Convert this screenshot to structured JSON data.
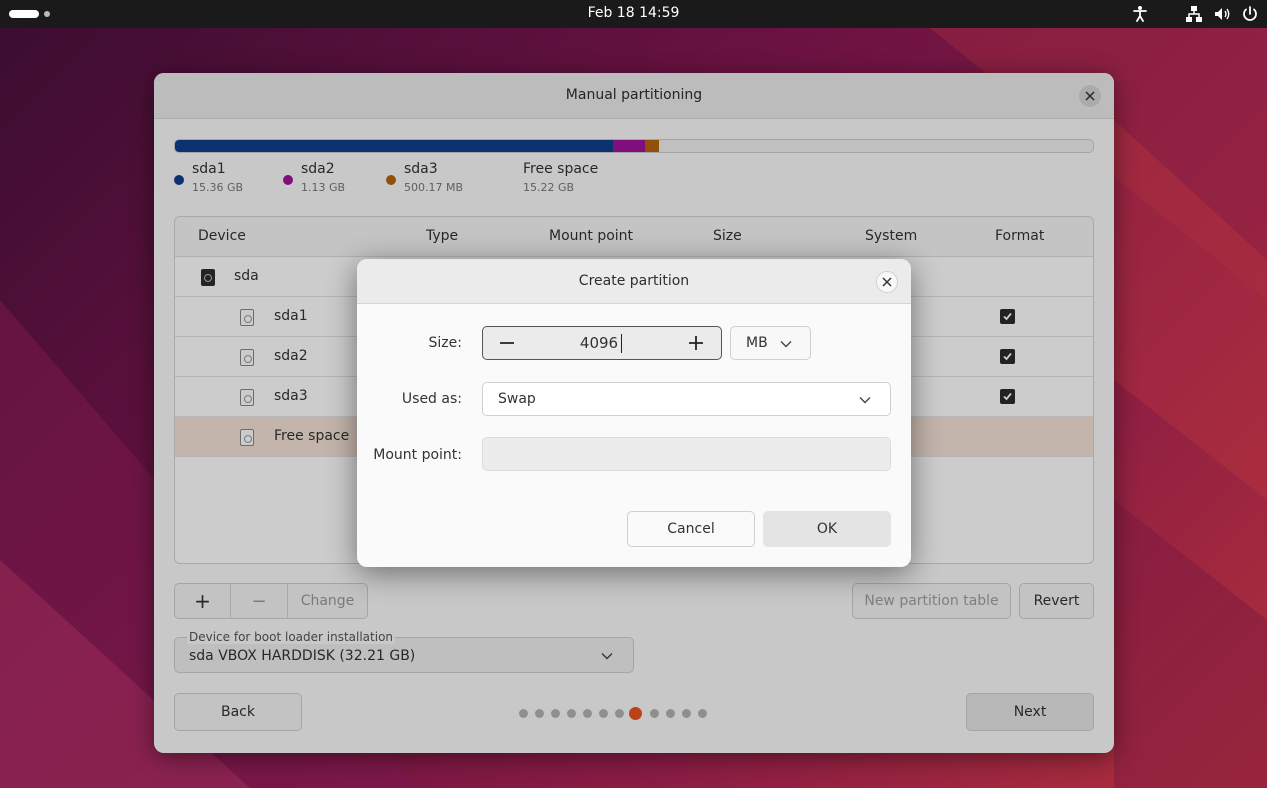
{
  "topbar": {
    "clock": "Feb 18  14:59",
    "icons": [
      "accessibility-icon",
      "network-icon",
      "volume-icon",
      "power-icon"
    ]
  },
  "window": {
    "title": "Manual partitioning",
    "usage_bar": [
      {
        "name": "sda1",
        "fraction": 0.4769,
        "color": "#0e3e8e"
      },
      {
        "name": "sda2",
        "fraction": 0.0351,
        "color": "#a0139a"
      },
      {
        "name": "sda3",
        "fraction": 0.0155,
        "color": "#b5650a"
      },
      {
        "name": "Free space",
        "fraction": 0.4725,
        "color": "#f0f0f0"
      }
    ],
    "legend": [
      {
        "name": "sda1",
        "size": "15.36 GB",
        "color": "#0e3e8e"
      },
      {
        "name": "sda2",
        "size": "1.13 GB",
        "color": "#a0139a"
      },
      {
        "name": "sda3",
        "size": "500.17 MB",
        "color": "#b5650a"
      },
      {
        "name": "Free space",
        "size": "15.22 GB"
      }
    ],
    "table": {
      "columns": [
        "Device",
        "Type",
        "Mount point",
        "Size",
        "System",
        "Format"
      ],
      "rows": [
        {
          "device": "sda",
          "level": 0,
          "format": false
        },
        {
          "device": "sda1",
          "level": 1,
          "format": true
        },
        {
          "device": "sda2",
          "level": 1,
          "format": true
        },
        {
          "device": "sda3",
          "level": 1,
          "format": true
        },
        {
          "device": "Free space",
          "level": 1,
          "format": false,
          "selected": true
        }
      ]
    },
    "toolbar": {
      "add": "+",
      "remove": "−",
      "change": "Change",
      "new_partition_table": "New partition table",
      "revert": "Revert"
    },
    "bootloader": {
      "label": "Device for boot loader installation",
      "value": "sda VBOX HARDDISK (32.21 GB)"
    },
    "nav": {
      "back": "Back",
      "next": "Next",
      "pages": 12,
      "current_page": 8
    }
  },
  "dialog": {
    "title": "Create partition",
    "size_label": "Size:",
    "size_value": "4096",
    "unit": "MB",
    "used_as_label": "Used as:",
    "used_as_value": "Swap",
    "mount_label": "Mount point:",
    "mount_value": "",
    "cancel": "Cancel",
    "ok": "OK"
  },
  "colors": {
    "accent": "#e95420",
    "selected_row": "#f4e3d7"
  }
}
